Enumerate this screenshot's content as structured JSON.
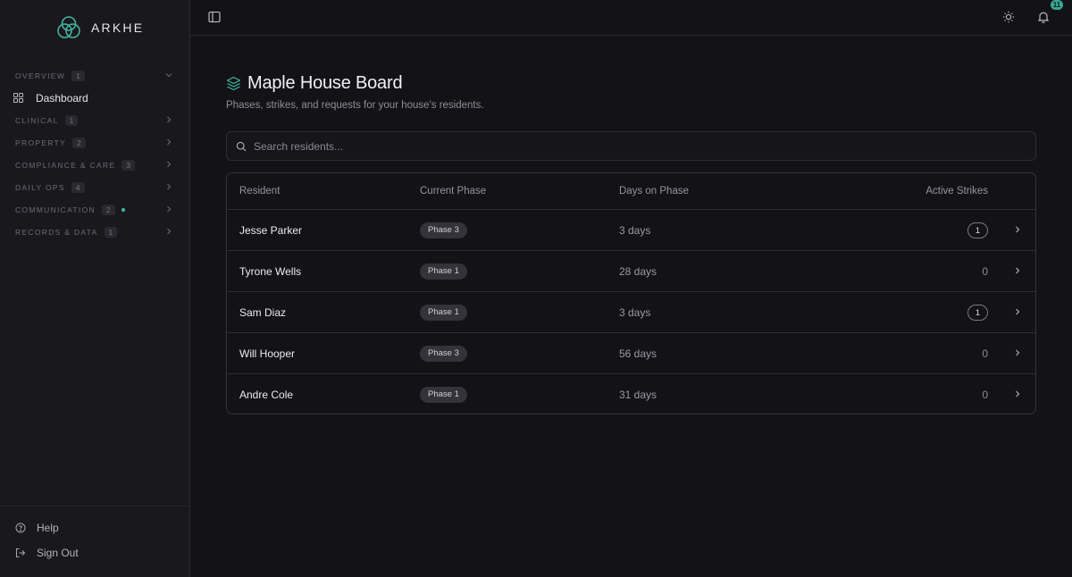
{
  "app": {
    "name": "ARKHE",
    "accent": "#42b8a4"
  },
  "sidebar": {
    "sections": [
      {
        "label": "OVERVIEW",
        "count": "1",
        "expanded": true,
        "items": [
          {
            "label": "Dashboard",
            "icon": "grid-icon"
          }
        ]
      },
      {
        "label": "CLINICAL",
        "count": "1"
      },
      {
        "label": "PROPERTY",
        "count": "2"
      },
      {
        "label": "COMPLIANCE & CARE",
        "count": "3"
      },
      {
        "label": "DAILY OPS",
        "count": "4"
      },
      {
        "label": "COMMUNICATION",
        "count": "2",
        "unread_dot": true
      },
      {
        "label": "RECORDS & DATA",
        "count": "1"
      }
    ],
    "footer": {
      "help_label": "Help",
      "signout_label": "Sign Out"
    }
  },
  "topbar": {
    "notification_count": "11"
  },
  "page": {
    "title": "Maple House Board",
    "subtitle": "Phases, strikes, and requests for your house's residents."
  },
  "search": {
    "placeholder": "Search residents..."
  },
  "table": {
    "columns": [
      "Resident",
      "Current Phase",
      "Days on Phase",
      "Active Strikes"
    ],
    "rows": [
      {
        "resident": "Jesse Parker",
        "phase": "Phase 3",
        "days": "3 days",
        "strikes": "1"
      },
      {
        "resident": "Tyrone Wells",
        "phase": "Phase 1",
        "days": "28 days",
        "strikes": "0"
      },
      {
        "resident": "Sam Diaz",
        "phase": "Phase 1",
        "days": "3 days",
        "strikes": "1"
      },
      {
        "resident": "Will Hooper",
        "phase": "Phase 3",
        "days": "56 days",
        "strikes": "0"
      },
      {
        "resident": "Andre Cole",
        "phase": "Phase 1",
        "days": "31 days",
        "strikes": "0"
      }
    ]
  }
}
